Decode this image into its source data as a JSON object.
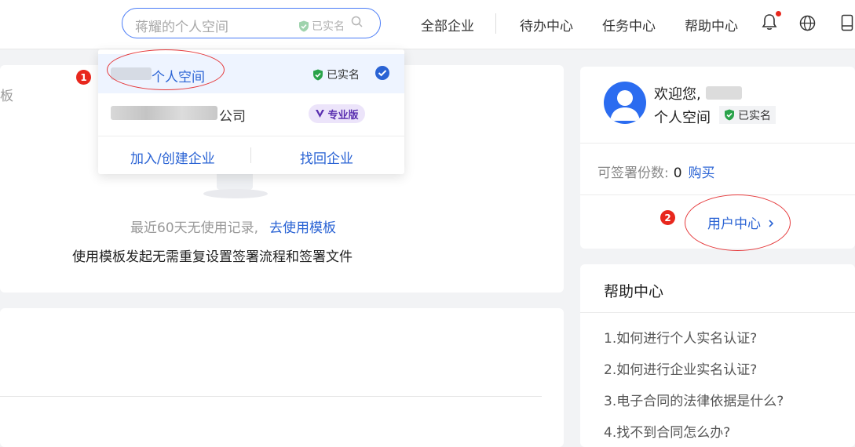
{
  "header": {
    "search_placeholder": "蒋耀的个人空间",
    "search_verified": "已实名",
    "nav": [
      "全部企业",
      "待办中心",
      "任务中心",
      "帮助中心"
    ]
  },
  "dropdown": {
    "personal_name": "个人空间",
    "personal_badge": "已实名",
    "company_suffix": "公司",
    "company_badge": "专业版",
    "action_join": "加入/创建企业",
    "action_recover": "找回企业"
  },
  "annotations": [
    "1",
    "2"
  ],
  "main": {
    "edge_char": "板",
    "no_record": "最近60天无使用记录,",
    "use_template_link": "去使用模板",
    "template_desc": "使用模板发起无需重复设置签署流程和签署文件"
  },
  "user_card": {
    "welcome": "欢迎您,",
    "space": "个人空间",
    "verified": "已实名",
    "sign_label": "可签署份数:",
    "sign_value": "0",
    "buy": "购买",
    "user_center": "用户中心"
  },
  "help": {
    "title": "帮助中心",
    "items": [
      "1.如何进行个人实名认证?",
      "2.如何进行企业实名认证?",
      "3.电子合同的法律依据是什么?",
      "4.找不到合同怎么办?"
    ]
  },
  "colors": {
    "accent": "#2a63d4",
    "verified_green": "#2aa34a",
    "annotation_red": "#e8271d"
  }
}
